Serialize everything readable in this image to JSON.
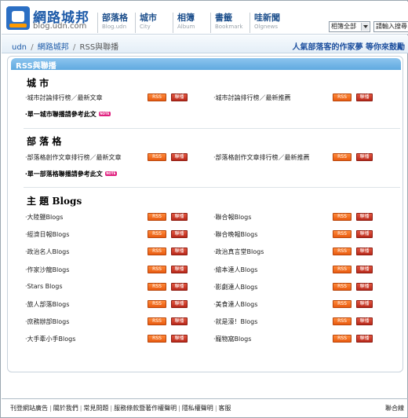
{
  "header": {
    "logo_title": "網路城邦",
    "logo_url": "blog.udn.com",
    "nav": [
      {
        "zh": "部落格",
        "en": "Blog.udn"
      },
      {
        "zh": "城市",
        "en": "City"
      },
      {
        "zh": "相簿",
        "en": "Album"
      },
      {
        "zh": "書籤",
        "en": "Bookmark"
      },
      {
        "zh": "哇新聞",
        "en": "Olgnews"
      }
    ],
    "search_scope": "相簿全部",
    "search_placeholder": "請輸入搜尋"
  },
  "breadcrumb": {
    "home": "udn",
    "level2": "網路城邦",
    "current": "RSS與聯播",
    "separator": "/"
  },
  "marquee_text": "人氣部落客的作家夢 等你來鼓勵",
  "panel_title": "RSS與聯播",
  "buttons": {
    "rss": "RSS",
    "subscribe": "聯播"
  },
  "note_badge": "NOTE",
  "sections": {
    "city": {
      "title": "城 市",
      "items": [
        "‧城市討論排行榜／最新文章",
        "‧城市討論排行榜／最新推薦"
      ],
      "single": "‧單一城市聯播請參考此文"
    },
    "blog": {
      "title": "部 落 格",
      "items": [
        "‧部落格創作文章排行榜／最新文章",
        "‧部落格創作文章排行榜／最新推薦"
      ],
      "single": "‧單一部落格聯播請參考此文"
    },
    "theme": {
      "title": "主 題 Blogs",
      "items": [
        "‧大陸鹽Blogs",
        "‧聯合報Blogs",
        "‧經濟日報Blogs",
        "‧聯合晚報Blogs",
        "‧政治名人Blogs",
        "‧政治真言堂Blogs",
        "‧作家沙龍Blogs",
        "‧繪本達人Blogs",
        "‧Stars Blogs",
        "‧影劇達人Blogs",
        "‧旅人部落Blogs",
        "‧美食達人Blogs",
        "‧庶務辦部Blogs",
        "‧就是濠！Blogs",
        "‧大手牽小手Blogs",
        "‧寵物窩Blogs"
      ]
    }
  },
  "footer": {
    "links": [
      "刊登網站廣告",
      "關於我們",
      "常見問題",
      "服務條款暨著作權聲明",
      "隱私權聲明",
      "客服"
    ],
    "right": "聯合線"
  }
}
